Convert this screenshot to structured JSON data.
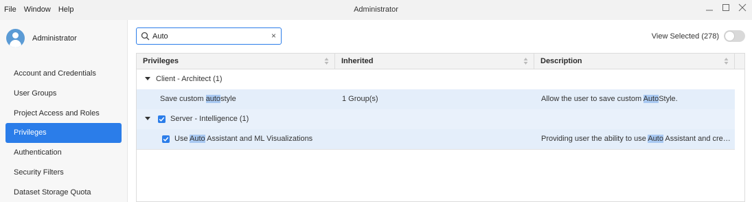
{
  "menu": [
    "File",
    "Window",
    "Help"
  ],
  "window_title": "Administrator",
  "user": {
    "name": "Administrator"
  },
  "sidebar": {
    "items": [
      {
        "label": "Account and Credentials"
      },
      {
        "label": "User Groups"
      },
      {
        "label": "Project Access and Roles"
      },
      {
        "label": "Privileges"
      },
      {
        "label": "Authentication"
      },
      {
        "label": "Security Filters"
      },
      {
        "label": "Dataset Storage Quota"
      }
    ],
    "active": "Privileges"
  },
  "search": {
    "value": "Auto",
    "clear_symbol": "×"
  },
  "view_selected": {
    "label": "View Selected (278)",
    "on": false
  },
  "table": {
    "columns": [
      "Privileges",
      "Inherited",
      "Description"
    ],
    "rows": [
      {
        "type": "group",
        "label": "Client - Architect (1)",
        "checked": false
      },
      {
        "type": "item",
        "privilege": {
          "pre": "Save custom ",
          "match": "auto",
          "post": "style"
        },
        "inherited": "1 Group(s)",
        "description": {
          "pre": "Allow the user to save custom ",
          "match": "Auto",
          "post": "Style."
        }
      },
      {
        "type": "group",
        "label": "Server - Intelligence (1)",
        "checked": true
      },
      {
        "type": "item",
        "checked": true,
        "privilege": {
          "pre": "Use ",
          "match": "Auto",
          "post": " Assistant and ML Visualizations"
        },
        "inherited": "",
        "description": {
          "pre": "Providing user the ability to use ",
          "match": "Auto",
          "post": " Assistant and create …"
        }
      }
    ]
  },
  "colors": {
    "accent": "#2b7de9",
    "highlight": "#a9c9f2",
    "selected_row": "#e4eefa"
  }
}
